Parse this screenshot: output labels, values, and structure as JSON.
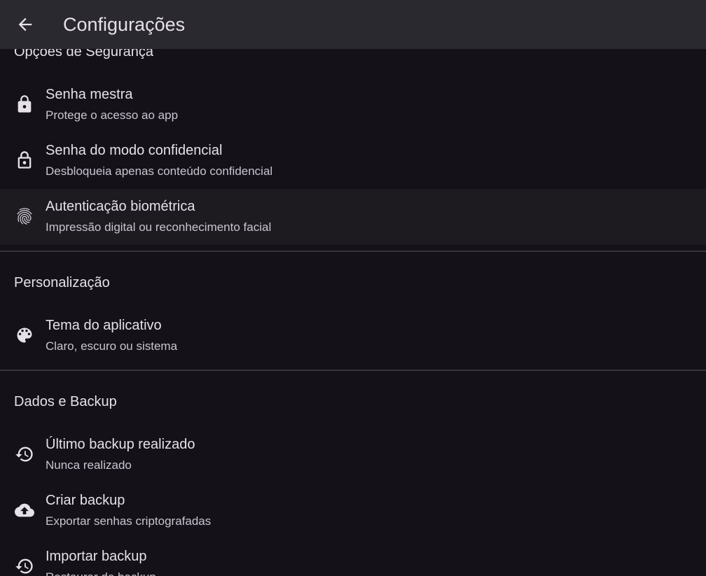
{
  "topbar": {
    "title": "Configurações",
    "back_icon": "arrow-back-icon"
  },
  "sections": {
    "security": {
      "header": "Opções de Segurança",
      "items": [
        {
          "title": "Senha mestra",
          "subtitle": "Protege o acesso ao app",
          "icon": "lock-filled-icon"
        },
        {
          "title": "Senha do modo confidencial",
          "subtitle": "Desbloqueia apenas conteúdo confidencial",
          "icon": "lock-outline-icon"
        },
        {
          "title": "Autenticação biométrica",
          "subtitle": "Impressão digital ou reconhecimento facial",
          "icon": "fingerprint-icon"
        }
      ]
    },
    "personalization": {
      "header": "Personalização",
      "items": [
        {
          "title": "Tema do aplicativo",
          "subtitle": "Claro, escuro ou sistema",
          "icon": "palette-icon"
        }
      ]
    },
    "backup": {
      "header": "Dados e Backup",
      "items": [
        {
          "title": "Último backup realizado",
          "subtitle": "Nunca realizado",
          "icon": "history-icon"
        },
        {
          "title": "Criar backup",
          "subtitle": "Exportar senhas criptografadas",
          "icon": "cloud-upload-icon"
        },
        {
          "title": "Importar backup",
          "subtitle": "Restaurar de backup",
          "icon": "restore-icon"
        }
      ]
    }
  },
  "colors": {
    "background": "#141218",
    "topbar": "#2b2930",
    "highlight": "#1d1b20",
    "divider": "#36343b",
    "text_primary": "#e6e0e9",
    "text_secondary": "#cac4d0"
  }
}
